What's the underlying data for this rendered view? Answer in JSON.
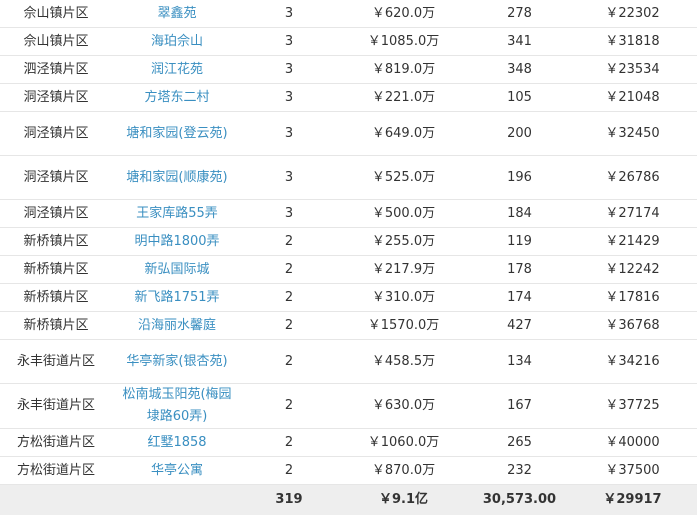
{
  "rows": [
    {
      "district": "佘山镇片区",
      "name": "翠鑫苑",
      "count": "3",
      "total": "￥620.0万",
      "area": "278",
      "avg": "￥22302"
    },
    {
      "district": "佘山镇片区",
      "name": "海珀佘山",
      "count": "3",
      "total": "￥1085.0万",
      "area": "341",
      "avg": "￥31818"
    },
    {
      "district": "泗泾镇片区",
      "name": "润江花苑",
      "count": "3",
      "total": "￥819.0万",
      "area": "348",
      "avg": "￥23534"
    },
    {
      "district": "洞泾镇片区",
      "name": "方塔东二村",
      "count": "3",
      "total": "￥221.0万",
      "area": "105",
      "avg": "￥21048"
    },
    {
      "district": "洞泾镇片区",
      "name": "塘和家园(登云苑)",
      "count": "3",
      "total": "￥649.0万",
      "area": "200",
      "avg": "￥32450"
    },
    {
      "district": "洞泾镇片区",
      "name": "塘和家园(顺康苑)",
      "count": "3",
      "total": "￥525.0万",
      "area": "196",
      "avg": "￥26786"
    },
    {
      "district": "洞泾镇片区",
      "name": "王家库路55弄",
      "count": "3",
      "total": "￥500.0万",
      "area": "184",
      "avg": "￥27174"
    },
    {
      "district": "新桥镇片区",
      "name": "明中路1800弄",
      "count": "2",
      "total": "￥255.0万",
      "area": "119",
      "avg": "￥21429"
    },
    {
      "district": "新桥镇片区",
      "name": "新弘国际城",
      "count": "2",
      "total": "￥217.9万",
      "area": "178",
      "avg": "￥12242"
    },
    {
      "district": "新桥镇片区",
      "name": "新飞路1751弄",
      "count": "2",
      "total": "￥310.0万",
      "area": "174",
      "avg": "￥17816"
    },
    {
      "district": "新桥镇片区",
      "name": "沿海丽水馨庭",
      "count": "2",
      "total": "￥1570.0万",
      "area": "427",
      "avg": "￥36768"
    },
    {
      "district": "永丰街道片区",
      "name": "华亭新家(银杏苑)",
      "count": "2",
      "total": "￥458.5万",
      "area": "134",
      "avg": "￥34216"
    },
    {
      "district": "永丰街道片区",
      "name": "松南城玉阳苑(梅园埭路60弄)",
      "count": "2",
      "total": "￥630.0万",
      "area": "167",
      "avg": "￥37725"
    },
    {
      "district": "方松街道片区",
      "name": "红墅1858",
      "count": "2",
      "total": "￥1060.0万",
      "area": "265",
      "avg": "￥40000"
    },
    {
      "district": "方松街道片区",
      "name": "华亭公寓",
      "count": "2",
      "total": "￥870.0万",
      "area": "232",
      "avg": "￥37500"
    }
  ],
  "totals": {
    "district": "",
    "name": "",
    "count": "319",
    "total": "￥9.1亿",
    "area": "30,573.00",
    "avg": "￥29917"
  },
  "colors": {
    "link": "#3a8fc1",
    "text": "#333333",
    "total_bg": "#eeeeee",
    "border": "#e6e6e6"
  }
}
